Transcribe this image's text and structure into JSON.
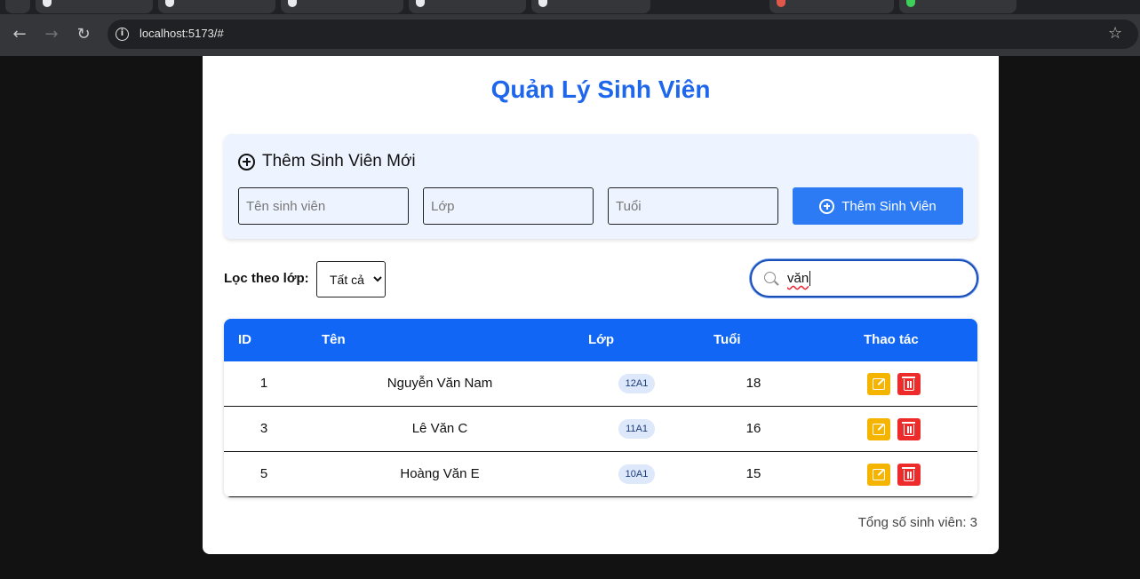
{
  "browser": {
    "url": "localhost:5173/#"
  },
  "app": {
    "title": "Quản Lý Sinh Viên",
    "add_section": {
      "heading": "Thêm Sinh Viên Mới",
      "name_placeholder": "Tên sinh viên",
      "class_placeholder": "Lớp",
      "age_placeholder": "Tuổi",
      "submit_label": "Thêm Sinh Viên"
    },
    "filter": {
      "label": "Lọc theo lớp:",
      "selected": "Tất cả"
    },
    "search": {
      "value": "văn"
    },
    "table": {
      "headers": {
        "id": "ID",
        "name": "Tên",
        "class": "Lớp",
        "age": "Tuổi",
        "actions": "Thao tác"
      },
      "rows": [
        {
          "id": "1",
          "name": "Nguyễn Văn Nam",
          "class": "12A1",
          "age": "18"
        },
        {
          "id": "3",
          "name": "Lê Văn C",
          "class": "11A1",
          "age": "16"
        },
        {
          "id": "5",
          "name": "Hoàng Văn E",
          "class": "10A1",
          "age": "15"
        }
      ]
    },
    "total": "Tổng số sinh viên: 3"
  },
  "colors": {
    "title": "#1e67ec",
    "header_bg": "#1266f5",
    "add_button": "#2c7bf5",
    "edit_button": "#f4b400",
    "delete_button": "#ee2b2b"
  }
}
